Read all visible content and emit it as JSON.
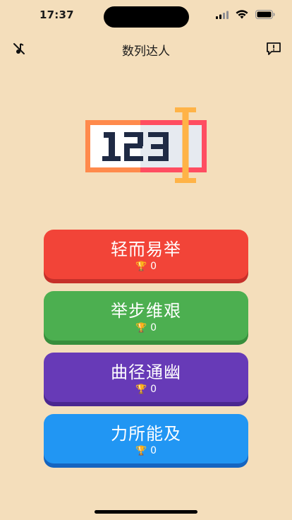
{
  "status_bar": {
    "time": "17:37"
  },
  "nav": {
    "title": "数列达人",
    "left_icon": "music-off-icon",
    "right_icon": "feedback-icon"
  },
  "logo": {
    "text": "123",
    "colors": {
      "left": "#FF8A4C",
      "right": "#FF4D61",
      "cursor": "#FFB347",
      "digits": "#1F2A44"
    }
  },
  "levels": [
    {
      "title": "轻而易举",
      "score": "0",
      "color": "#F24438",
      "shadow": "#C6302A"
    },
    {
      "title": "举步维艰",
      "score": "0",
      "color": "#4CAF50",
      "shadow": "#388E3C"
    },
    {
      "title": "曲径通幽",
      "score": "0",
      "color": "#673AB7",
      "shadow": "#4B2790"
    },
    {
      "title": "力所能及",
      "score": "0",
      "color": "#2196F3",
      "shadow": "#1565C0"
    }
  ]
}
